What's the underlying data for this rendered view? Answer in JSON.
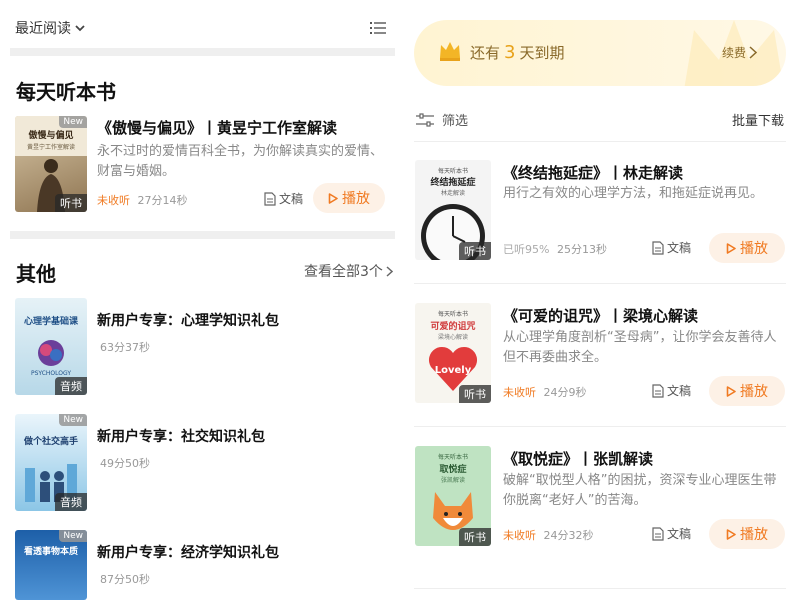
{
  "left": {
    "recent_label": "最近阅读",
    "section_daily": "每天听本书",
    "featured": {
      "cover_title": "傲慢与偏见",
      "cover_sub": "黄昱宁工作室解读",
      "new_badge": "New",
      "type_badge": "听书",
      "title": "《傲慢与偏见》丨黄昱宁工作室解读",
      "desc": "永不过时的爱情百科全书，为你解读真实的爱情、财富与婚姻。",
      "status": "未收听",
      "duration": "27分14秒",
      "doc_label": "文稿",
      "play_label": "播放"
    },
    "section_other": "其他",
    "view_all": "查看全部3个",
    "packs": [
      {
        "cover_title": "心理学基础课",
        "cover_sub": "PSYCHOLOGY",
        "badge": "音频",
        "new_badge": "",
        "title": "新用户专享：心理学知识礼包",
        "duration": "63分37秒"
      },
      {
        "cover_title": "做个社交高手",
        "cover_sub": "",
        "badge": "音频",
        "new_badge": "New",
        "title": "新用户专享：社交知识礼包",
        "duration": "49分50秒"
      },
      {
        "cover_title": "看透事物本质",
        "cover_sub": "",
        "badge": "",
        "new_badge": "New",
        "title": "新用户专享：经济学知识礼包",
        "duration": "87分50秒"
      }
    ]
  },
  "right": {
    "vip_prefix": "还有",
    "vip_days": "3",
    "vip_suffix": "天到期",
    "renew": "续费",
    "filter": "筛选",
    "batch": "批量下载",
    "books": [
      {
        "cover_title": "终结拖延症",
        "cover_sub": "林走解读",
        "type_badge": "听书",
        "title": "《终结拖延症》丨林走解读",
        "desc": "用行之有效的心理学方法，和拖延症说再见。",
        "status": "已听95%",
        "duration": "25分13秒",
        "doc_label": "文稿",
        "play_label": "播放"
      },
      {
        "cover_title": "可爱的诅咒",
        "cover_sub": "梁境心解读",
        "cover_word": "Lovely",
        "type_badge": "听书",
        "title": "《可爱的诅咒》丨梁境心解读",
        "desc": "从心理学角度剖析“圣母病”，让你学会友善待人但不再委曲求全。",
        "status": "未收听",
        "duration": "24分9秒",
        "doc_label": "文稿",
        "play_label": "播放"
      },
      {
        "cover_title": "取悦症",
        "cover_sub": "张凯解读",
        "type_badge": "听书",
        "title": "《取悦症》丨张凯解读",
        "desc": "破解“取悦型人格”的困扰，资深专业心理医生带你脱离“老好人”的苦海。",
        "status": "未收听",
        "duration": "24分32秒",
        "doc_label": "文稿",
        "play_label": "播放"
      }
    ],
    "cover_header": "每天听本书"
  },
  "colors": {
    "accent": "#f07a22",
    "gold": "#e8a21a"
  }
}
